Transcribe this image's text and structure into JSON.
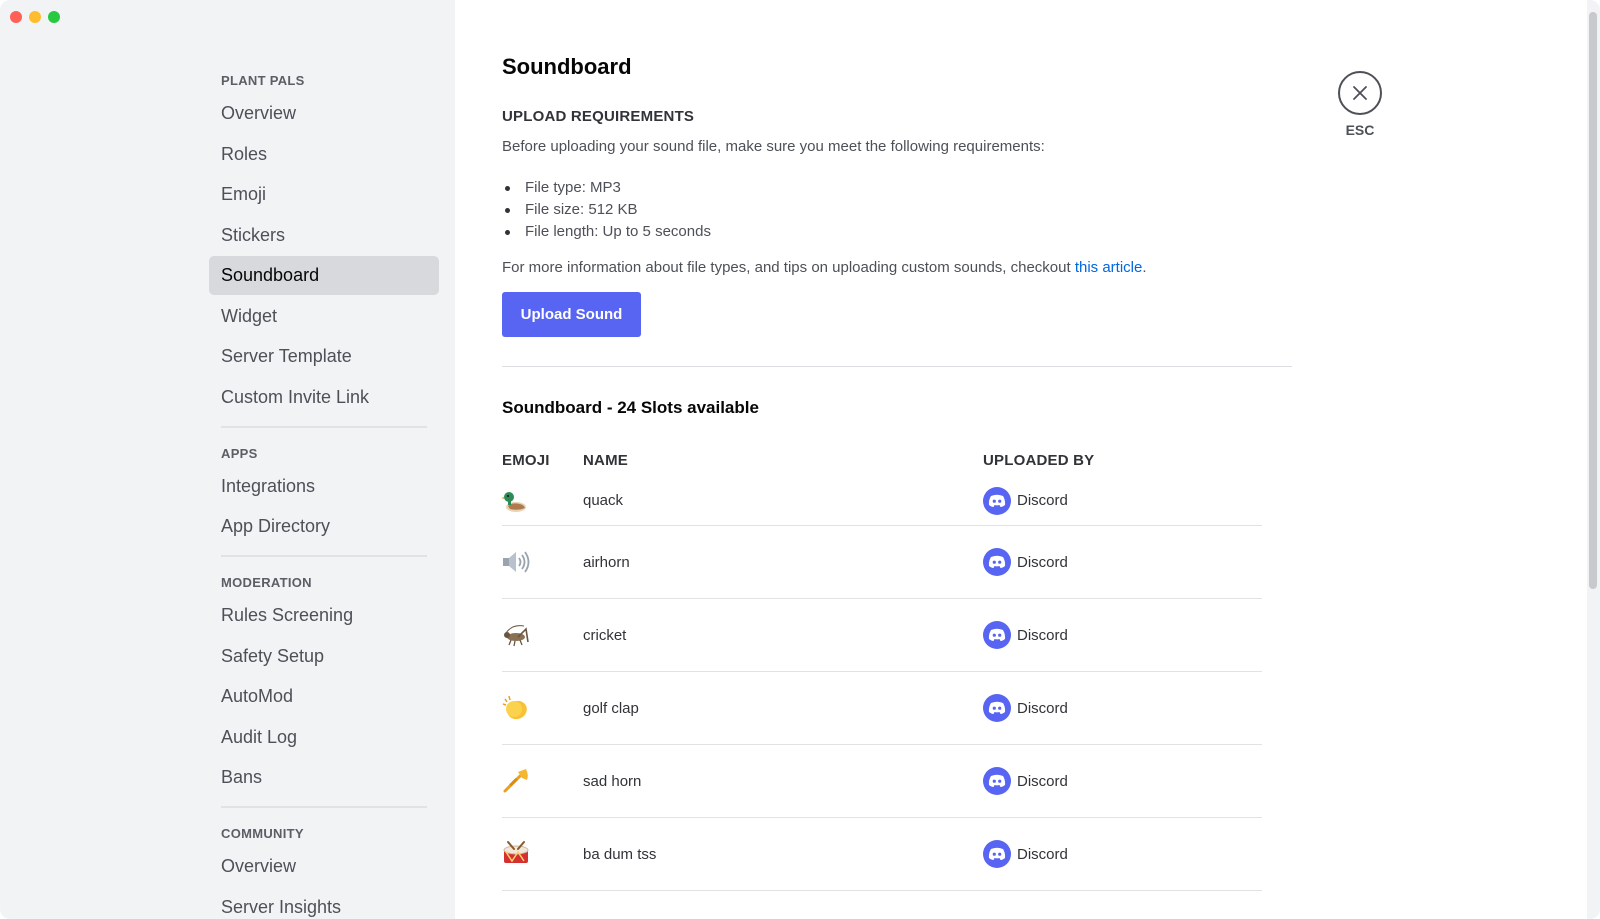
{
  "window": {
    "controls": [
      "close",
      "minimize",
      "zoom"
    ]
  },
  "sidebar": {
    "sections": [
      {
        "header": "PLANT PALS",
        "items": [
          "Overview",
          "Roles",
          "Emoji",
          "Stickers",
          "Soundboard",
          "Widget",
          "Server Template",
          "Custom Invite Link"
        ]
      },
      {
        "header": "APPS",
        "items": [
          "Integrations",
          "App Directory"
        ]
      },
      {
        "header": "MODERATION",
        "items": [
          "Rules Screening",
          "Safety Setup",
          "AutoMod",
          "Audit Log",
          "Bans"
        ]
      },
      {
        "header": "COMMUNITY",
        "items": [
          "Overview",
          "Server Insights"
        ]
      }
    ],
    "selected": "Soundboard"
  },
  "main": {
    "title": "Soundboard",
    "requirements_heading": "UPLOAD REQUIREMENTS",
    "requirements_desc": "Before uploading your sound file, make sure you meet the following requirements:",
    "requirements": [
      "File type: MP3",
      "File size: 512 KB",
      "File length: Up to 5 seconds"
    ],
    "more_info_prefix": "For more information about file types, and tips on uploading custom sounds, checkout ",
    "more_info_link": "this article",
    "more_info_suffix": ".",
    "upload_button": "Upload Sound",
    "slots_heading": "Soundboard - 24 Slots available",
    "table": {
      "columns": [
        "EMOJI",
        "NAME",
        "UPLOADED BY"
      ],
      "rows": [
        {
          "emoji": "duck-icon",
          "name": "quack",
          "uploaded_by": "Discord"
        },
        {
          "emoji": "speaker-icon",
          "name": "airhorn",
          "uploaded_by": "Discord"
        },
        {
          "emoji": "cricket-icon",
          "name": "cricket",
          "uploaded_by": "Discord"
        },
        {
          "emoji": "clapping-hands-icon",
          "name": "golf clap",
          "uploaded_by": "Discord"
        },
        {
          "emoji": "trumpet-icon",
          "name": "sad horn",
          "uploaded_by": "Discord"
        },
        {
          "emoji": "drum-icon",
          "name": "ba dum tss",
          "uploaded_by": "Discord"
        }
      ]
    }
  },
  "close": {
    "label": "ESC"
  },
  "colors": {
    "accent": "#5865f2",
    "link": "#0068e0",
    "sidebar_bg": "#f2f3f5",
    "selected_bg": "#d7d9dc"
  }
}
